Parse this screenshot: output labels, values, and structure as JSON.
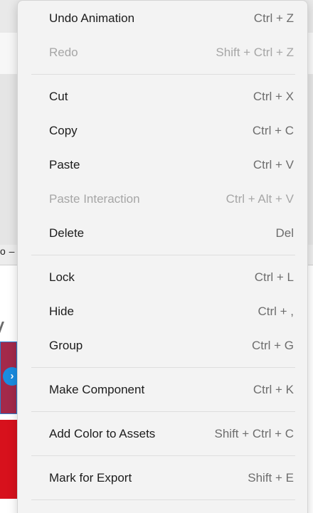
{
  "background": {
    "label_fragment": "o –",
    "handle_glyph": "›"
  },
  "colors": {
    "menu_bg": "#f3f3f3",
    "text": "#1c1c1c",
    "shortcut_text": "#6d6d6d",
    "disabled_text": "#a6a6a6",
    "accent": "#1a8ce0"
  },
  "menu": {
    "items": [
      {
        "label": "Undo Animation",
        "shortcut": "Ctrl + Z",
        "enabled": true
      },
      {
        "label": "Redo",
        "shortcut": "Shift + Ctrl + Z",
        "enabled": false
      },
      {
        "label": "Cut",
        "shortcut": "Ctrl + X",
        "enabled": true
      },
      {
        "label": "Copy",
        "shortcut": "Ctrl + C",
        "enabled": true
      },
      {
        "label": "Paste",
        "shortcut": "Ctrl + V",
        "enabled": true
      },
      {
        "label": "Paste Interaction",
        "shortcut": "Ctrl + Alt + V",
        "enabled": false
      },
      {
        "label": "Delete",
        "shortcut": "Del",
        "enabled": true
      },
      {
        "label": "Lock",
        "shortcut": "Ctrl + L",
        "enabled": true
      },
      {
        "label": "Hide",
        "shortcut": "Ctrl + ,",
        "enabled": true
      },
      {
        "label": "Group",
        "shortcut": "Ctrl + G",
        "enabled": true
      },
      {
        "label": "Make Component",
        "shortcut": "Ctrl + K",
        "enabled": true
      },
      {
        "label": "Add Color to Assets",
        "shortcut": "Shift + Ctrl + C",
        "enabled": true
      },
      {
        "label": "Mark for Export",
        "shortcut": "Shift + E",
        "enabled": true
      }
    ]
  }
}
